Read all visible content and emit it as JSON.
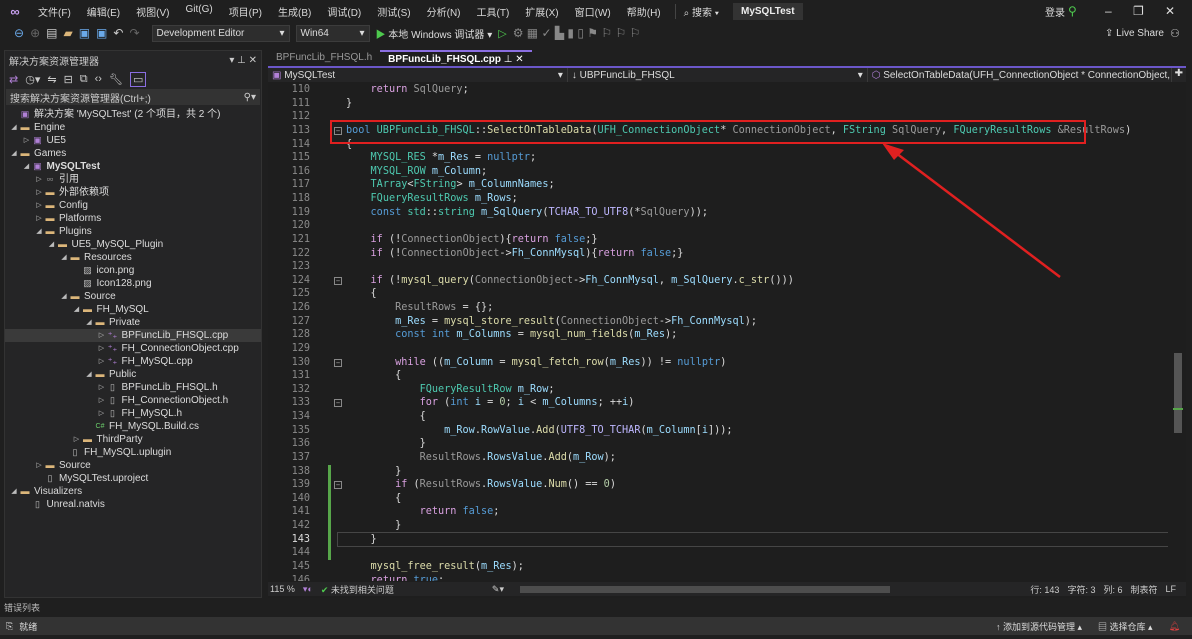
{
  "menu": {
    "items": [
      "文件(F)",
      "编辑(E)",
      "视图(V)",
      "Git(G)",
      "项目(P)",
      "生成(B)",
      "调试(D)",
      "测试(S)",
      "分析(N)",
      "工具(T)",
      "扩展(X)",
      "窗口(W)",
      "帮助(H)"
    ],
    "search": "搜索",
    "project": "MySQLTest",
    "login": "登录"
  },
  "toolbar": {
    "config": "Development Editor",
    "platform": "Win64",
    "debugger": "本地 Windows 调试器",
    "live_share": "Live Share"
  },
  "solution": {
    "title": "解决方案资源管理器",
    "search_placeholder": "搜索解决方案资源管理器(Ctrl+;)",
    "tree": [
      {
        "label": "解决方案 'MySQLTest' (2 个项目，共 2 个)",
        "depth": 0,
        "tw": "",
        "icon": "sln"
      },
      {
        "label": "Engine",
        "depth": 0,
        "tw": "open",
        "icon": "folder"
      },
      {
        "label": "UE5",
        "depth": 1,
        "tw": "closed",
        "icon": "proj"
      },
      {
        "label": "Games",
        "depth": 0,
        "tw": "open",
        "icon": "folder"
      },
      {
        "label": "MySQLTest",
        "depth": 1,
        "tw": "open",
        "icon": "proj",
        "bold": true
      },
      {
        "label": "引用",
        "depth": 2,
        "tw": "closed",
        "icon": "ref"
      },
      {
        "label": "外部依赖项",
        "depth": 2,
        "tw": "closed",
        "icon": "folder"
      },
      {
        "label": "Config",
        "depth": 2,
        "tw": "closed",
        "icon": "folder"
      },
      {
        "label": "Platforms",
        "depth": 2,
        "tw": "closed",
        "icon": "folder"
      },
      {
        "label": "Plugins",
        "depth": 2,
        "tw": "open",
        "icon": "folder"
      },
      {
        "label": "UE5_MySQL_Plugin",
        "depth": 3,
        "tw": "open",
        "icon": "folder"
      },
      {
        "label": "Resources",
        "depth": 4,
        "tw": "open",
        "icon": "folder"
      },
      {
        "label": "icon.png",
        "depth": 5,
        "tw": "",
        "icon": "img"
      },
      {
        "label": "Icon128.png",
        "depth": 5,
        "tw": "",
        "icon": "img"
      },
      {
        "label": "Source",
        "depth": 4,
        "tw": "open",
        "icon": "folder"
      },
      {
        "label": "FH_MySQL",
        "depth": 5,
        "tw": "open",
        "icon": "folder"
      },
      {
        "label": "Private",
        "depth": 6,
        "tw": "open",
        "icon": "folder"
      },
      {
        "label": "BPFuncLib_FHSQL.cpp",
        "depth": 7,
        "tw": "closed",
        "icon": "cpp",
        "selected": true
      },
      {
        "label": "FH_ConnectionObject.cpp",
        "depth": 7,
        "tw": "closed",
        "icon": "cpp"
      },
      {
        "label": "FH_MySQL.cpp",
        "depth": 7,
        "tw": "closed",
        "icon": "cpp"
      },
      {
        "label": "Public",
        "depth": 6,
        "tw": "open",
        "icon": "folder"
      },
      {
        "label": "BPFuncLib_FHSQL.h",
        "depth": 7,
        "tw": "closed",
        "icon": "h"
      },
      {
        "label": "FH_ConnectionObject.h",
        "depth": 7,
        "tw": "closed",
        "icon": "h"
      },
      {
        "label": "FH_MySQL.h",
        "depth": 7,
        "tw": "closed",
        "icon": "h"
      },
      {
        "label": "FH_MySQL.Build.cs",
        "depth": 6,
        "tw": "",
        "icon": "cs"
      },
      {
        "label": "ThirdParty",
        "depth": 5,
        "tw": "closed",
        "icon": "folder"
      },
      {
        "label": "FH_MySQL.uplugin",
        "depth": 4,
        "tw": "",
        "icon": "file"
      },
      {
        "label": "Source",
        "depth": 2,
        "tw": "closed",
        "icon": "folder"
      },
      {
        "label": "MySQLTest.uproject",
        "depth": 2,
        "tw": "",
        "icon": "file"
      },
      {
        "label": "Visualizers",
        "depth": 0,
        "tw": "open",
        "icon": "folder"
      },
      {
        "label": "Unreal.natvis",
        "depth": 1,
        "tw": "",
        "icon": "file"
      }
    ]
  },
  "editor": {
    "tabs": [
      {
        "label": "BPFuncLib_FHSQL.h",
        "active": false
      },
      {
        "label": "BPFuncLib_FHSQL.cpp",
        "active": true
      }
    ],
    "nav": {
      "project": "MySQLTest",
      "scope": "UBPFuncLib_FHSQL",
      "member": "SelectOnTableData(UFH_ConnectionObject * ConnectionObject, FStri"
    },
    "current_line": 143,
    "lines": [
      {
        "n": 110,
        "t": [
          [
            "    ",
            "pl"
          ],
          [
            "return ",
            "ctl"
          ],
          [
            "SqlQuery",
            "param"
          ],
          [
            ";",
            "pl"
          ]
        ]
      },
      {
        "n": 111,
        "t": [
          [
            "}",
            "pl"
          ]
        ]
      },
      {
        "n": 112,
        "t": []
      },
      {
        "n": 113,
        "fold": true,
        "t": [
          [
            "bool ",
            "kw"
          ],
          [
            "UBPFuncLib_FHSQL",
            "type"
          ],
          [
            "::",
            "pl"
          ],
          [
            "SelectOnTableData",
            "fn"
          ],
          [
            "(",
            "pl"
          ],
          [
            "UFH_ConnectionObject",
            "type"
          ],
          [
            "* ",
            "pl"
          ],
          [
            "ConnectionObject",
            "param"
          ],
          [
            ", ",
            "pl"
          ],
          [
            "FString ",
            "type"
          ],
          [
            "SqlQuery",
            "param"
          ],
          [
            ", ",
            "pl"
          ],
          [
            "FQueryResultRows ",
            "type"
          ],
          [
            "&ResultRows",
            "param"
          ],
          [
            ")",
            "pl"
          ]
        ]
      },
      {
        "n": 114,
        "t": [
          [
            "{",
            "pl"
          ]
        ]
      },
      {
        "n": 115,
        "t": [
          [
            "    ",
            "pl"
          ],
          [
            "MYSQL_RES ",
            "type"
          ],
          [
            "*",
            "pl"
          ],
          [
            "m_Res",
            "var"
          ],
          [
            " = ",
            "pl"
          ],
          [
            "nullptr",
            "kw"
          ],
          [
            ";",
            "pl"
          ]
        ]
      },
      {
        "n": 116,
        "t": [
          [
            "    ",
            "pl"
          ],
          [
            "MYSQL_ROW ",
            "type"
          ],
          [
            "m_Column",
            "var"
          ],
          [
            ";",
            "pl"
          ]
        ]
      },
      {
        "n": 117,
        "t": [
          [
            "    ",
            "pl"
          ],
          [
            "TArray",
            "type"
          ],
          [
            "<",
            "pl"
          ],
          [
            "FString",
            "type"
          ],
          [
            "> ",
            "pl"
          ],
          [
            "m_ColumnNames",
            "var"
          ],
          [
            ";",
            "pl"
          ]
        ]
      },
      {
        "n": 118,
        "t": [
          [
            "    ",
            "pl"
          ],
          [
            "FQueryResultRows ",
            "type"
          ],
          [
            "m_Rows",
            "var"
          ],
          [
            ";",
            "pl"
          ]
        ]
      },
      {
        "n": 119,
        "t": [
          [
            "    ",
            "pl"
          ],
          [
            "const ",
            "kw"
          ],
          [
            "std",
            "type"
          ],
          [
            "::",
            "pl"
          ],
          [
            "string ",
            "type"
          ],
          [
            "m_SqlQuery",
            "var"
          ],
          [
            "(",
            "pl"
          ],
          [
            "TCHAR_TO_UTF8",
            "macro"
          ],
          [
            "(*",
            "pl"
          ],
          [
            "SqlQuery",
            "param"
          ],
          [
            "));",
            "pl"
          ]
        ]
      },
      {
        "n": 120,
        "t": []
      },
      {
        "n": 121,
        "t": [
          [
            "    ",
            "pl"
          ],
          [
            "if ",
            "ctl"
          ],
          [
            "(!",
            "pl"
          ],
          [
            "ConnectionObject",
            "param"
          ],
          [
            "){",
            "pl"
          ],
          [
            "return ",
            "ctl"
          ],
          [
            "false",
            "kw"
          ],
          [
            ";}",
            "pl"
          ]
        ]
      },
      {
        "n": 122,
        "t": [
          [
            "    ",
            "pl"
          ],
          [
            "if ",
            "ctl"
          ],
          [
            "(!",
            "pl"
          ],
          [
            "ConnectionObject",
            "param"
          ],
          [
            "->",
            "pl"
          ],
          [
            "Fh_ConnMysql",
            "var"
          ],
          [
            "){",
            "pl"
          ],
          [
            "return ",
            "ctl"
          ],
          [
            "false",
            "kw"
          ],
          [
            ";}",
            "pl"
          ]
        ]
      },
      {
        "n": 123,
        "t": []
      },
      {
        "n": 124,
        "fold": true,
        "t": [
          [
            "    ",
            "pl"
          ],
          [
            "if ",
            "ctl"
          ],
          [
            "(!",
            "pl"
          ],
          [
            "mysql_query",
            "fn"
          ],
          [
            "(",
            "pl"
          ],
          [
            "ConnectionObject",
            "param"
          ],
          [
            "->",
            "pl"
          ],
          [
            "Fh_ConnMysql",
            "var"
          ],
          [
            ", ",
            "pl"
          ],
          [
            "m_SqlQuery",
            "var"
          ],
          [
            ".",
            "pl"
          ],
          [
            "c_str",
            "fn"
          ],
          [
            "()))",
            "pl"
          ]
        ]
      },
      {
        "n": 125,
        "t": [
          [
            "    {",
            "pl"
          ]
        ]
      },
      {
        "n": 126,
        "t": [
          [
            "        ",
            "pl"
          ],
          [
            "ResultRows",
            "param"
          ],
          [
            " = {};",
            "pl"
          ]
        ]
      },
      {
        "n": 127,
        "t": [
          [
            "        ",
            "pl"
          ],
          [
            "m_Res",
            "var"
          ],
          [
            " = ",
            "pl"
          ],
          [
            "mysql_store_result",
            "fn"
          ],
          [
            "(",
            "pl"
          ],
          [
            "ConnectionObject",
            "param"
          ],
          [
            "->",
            "pl"
          ],
          [
            "Fh_ConnMysql",
            "var"
          ],
          [
            ");",
            "pl"
          ]
        ]
      },
      {
        "n": 128,
        "t": [
          [
            "        ",
            "pl"
          ],
          [
            "const int ",
            "kw"
          ],
          [
            "m_Columns",
            "var"
          ],
          [
            " = ",
            "pl"
          ],
          [
            "mysql_num_fields",
            "fn"
          ],
          [
            "(",
            "pl"
          ],
          [
            "m_Res",
            "var"
          ],
          [
            ");",
            "pl"
          ]
        ]
      },
      {
        "n": 129,
        "t": []
      },
      {
        "n": 130,
        "fold": true,
        "t": [
          [
            "        ",
            "pl"
          ],
          [
            "while ",
            "ctl"
          ],
          [
            "((",
            "pl"
          ],
          [
            "m_Column",
            "var"
          ],
          [
            " = ",
            "pl"
          ],
          [
            "mysql_fetch_row",
            "fn"
          ],
          [
            "(",
            "pl"
          ],
          [
            "m_Res",
            "var"
          ],
          [
            ")) != ",
            "pl"
          ],
          [
            "nullptr",
            "kw"
          ],
          [
            ")",
            "pl"
          ]
        ]
      },
      {
        "n": 131,
        "t": [
          [
            "        {",
            "pl"
          ]
        ]
      },
      {
        "n": 132,
        "t": [
          [
            "            ",
            "pl"
          ],
          [
            "FQueryResultRow ",
            "type"
          ],
          [
            "m_Row",
            "var"
          ],
          [
            ";",
            "pl"
          ]
        ]
      },
      {
        "n": 133,
        "fold": true,
        "t": [
          [
            "            ",
            "pl"
          ],
          [
            "for ",
            "ctl"
          ],
          [
            "(",
            "pl"
          ],
          [
            "int ",
            "kw"
          ],
          [
            "i",
            "var"
          ],
          [
            " = ",
            "pl"
          ],
          [
            "0",
            "num"
          ],
          [
            "; ",
            "pl"
          ],
          [
            "i",
            "var"
          ],
          [
            " < ",
            "pl"
          ],
          [
            "m_Columns",
            "var"
          ],
          [
            "; ++",
            "pl"
          ],
          [
            "i",
            "var"
          ],
          [
            ")",
            "pl"
          ]
        ]
      },
      {
        "n": 134,
        "t": [
          [
            "            {",
            "pl"
          ]
        ]
      },
      {
        "n": 135,
        "t": [
          [
            "                ",
            "pl"
          ],
          [
            "m_Row",
            "var"
          ],
          [
            ".",
            "pl"
          ],
          [
            "RowValue",
            "var"
          ],
          [
            ".",
            "pl"
          ],
          [
            "Add",
            "fn"
          ],
          [
            "(",
            "pl"
          ],
          [
            "UTF8_TO_TCHAR",
            "macro"
          ],
          [
            "(",
            "pl"
          ],
          [
            "m_Column",
            "var"
          ],
          [
            "[",
            "pl"
          ],
          [
            "i",
            "var"
          ],
          [
            "]));",
            "pl"
          ]
        ]
      },
      {
        "n": 136,
        "t": [
          [
            "            }",
            "pl"
          ]
        ]
      },
      {
        "n": 137,
        "t": [
          [
            "            ",
            "pl"
          ],
          [
            "ResultRows",
            "param"
          ],
          [
            ".",
            "pl"
          ],
          [
            "RowsValue",
            "var"
          ],
          [
            ".",
            "pl"
          ],
          [
            "Add",
            "fn"
          ],
          [
            "(",
            "pl"
          ],
          [
            "m_Row",
            "var"
          ],
          [
            ");",
            "pl"
          ]
        ]
      },
      {
        "n": 138,
        "chg": true,
        "t": [
          [
            "        }",
            "pl"
          ]
        ]
      },
      {
        "n": 139,
        "chg": true,
        "fold": true,
        "t": [
          [
            "        ",
            "pl"
          ],
          [
            "if ",
            "ctl"
          ],
          [
            "(",
            "pl"
          ],
          [
            "ResultRows",
            "param"
          ],
          [
            ".",
            "pl"
          ],
          [
            "RowsValue",
            "var"
          ],
          [
            ".",
            "pl"
          ],
          [
            "Num",
            "fn"
          ],
          [
            "() == ",
            "pl"
          ],
          [
            "0",
            "num"
          ],
          [
            ")",
            "pl"
          ]
        ]
      },
      {
        "n": 140,
        "chg": true,
        "t": [
          [
            "        {",
            "pl"
          ]
        ]
      },
      {
        "n": 141,
        "chg": true,
        "t": [
          [
            "            ",
            "pl"
          ],
          [
            "return ",
            "ctl"
          ],
          [
            "false",
            "kw"
          ],
          [
            ";",
            "pl"
          ]
        ]
      },
      {
        "n": 142,
        "chg": true,
        "t": [
          [
            "        }",
            "pl"
          ]
        ]
      },
      {
        "n": 143,
        "chg": true,
        "t": [
          [
            "    }",
            "pl"
          ]
        ]
      },
      {
        "n": 144,
        "chg": true,
        "t": []
      },
      {
        "n": 145,
        "t": [
          [
            "    ",
            "pl"
          ],
          [
            "mysql_free_result",
            "fn"
          ],
          [
            "(",
            "pl"
          ],
          [
            "m_Res",
            "var"
          ],
          [
            ");",
            "pl"
          ]
        ]
      },
      {
        "n": 146,
        "t": [
          [
            "    ",
            "pl"
          ],
          [
            "return ",
            "ctl"
          ],
          [
            "true",
            "kw"
          ],
          [
            ";",
            "pl"
          ]
        ]
      }
    ],
    "status": {
      "zoom": "115 %",
      "issues": "未找到相关问题",
      "line": "行: 143",
      "char": "字符: 3",
      "col": "列: 6",
      "tabs": "制表符",
      "eol": "LF"
    }
  },
  "bottom": {
    "error_list": "错误列表",
    "ready": "就绪",
    "add_source": "添加到源代码管理",
    "select_repo": "选择仓库"
  },
  "colors": {
    "accent": "#8a6ee0",
    "highlight_box": "#e02020",
    "change_bar": "#57a64a"
  }
}
